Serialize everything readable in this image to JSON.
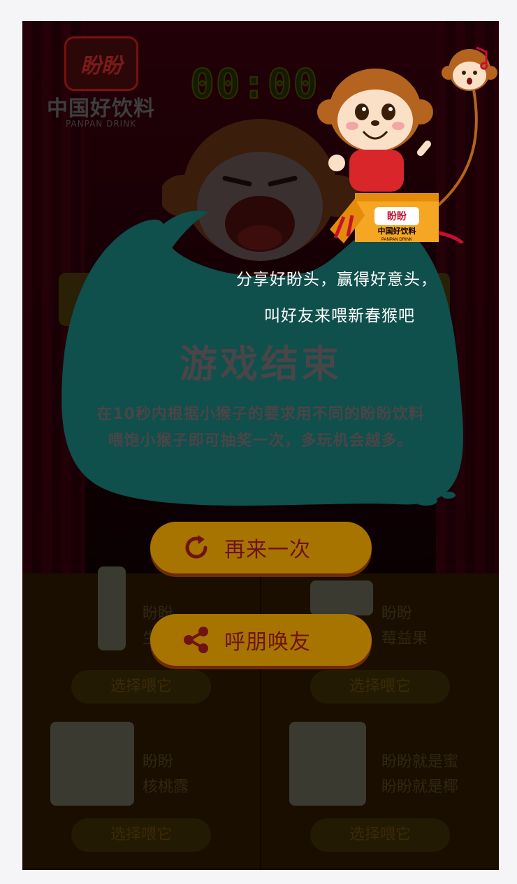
{
  "brand": {
    "logo_text": "盼盼",
    "name": "中国好饮料",
    "sub": "PANPAN DRINK"
  },
  "timer": "00:00",
  "popup": {
    "title": "游戏结束",
    "desc_line1": "在10秒内根据小猴子的要求用不同的盼盼饮料",
    "desc_line2": "喂饱小猴子即可抽奖一次，多玩机会越多。",
    "share_line1": "分享好盼头，赢得好意头，",
    "share_line2": "叫好友来喂新春猴吧"
  },
  "buttons": {
    "retry": "再来一次",
    "share": "呼朋唤友"
  },
  "drinks": [
    {
      "line1": "盼盼",
      "line2": "生榨",
      "choose": "选择喂它"
    },
    {
      "line1": "盼盼",
      "line2": "莓益果",
      "choose": "选择喂它"
    },
    {
      "line1": "盼盼",
      "line2": "核桃露",
      "choose": "选择喂它"
    },
    {
      "line1": "盼盼就是蜜",
      "line2": "盼盼就是椰",
      "choose": "选择喂它"
    }
  ],
  "box_label": {
    "logo": "盼盼",
    "name": "中国好饮料",
    "sub": "PANPAN DRINK"
  },
  "colors": {
    "bubble": "#0f4f4c",
    "button": "#a77400",
    "button_text": "#6e1313"
  }
}
